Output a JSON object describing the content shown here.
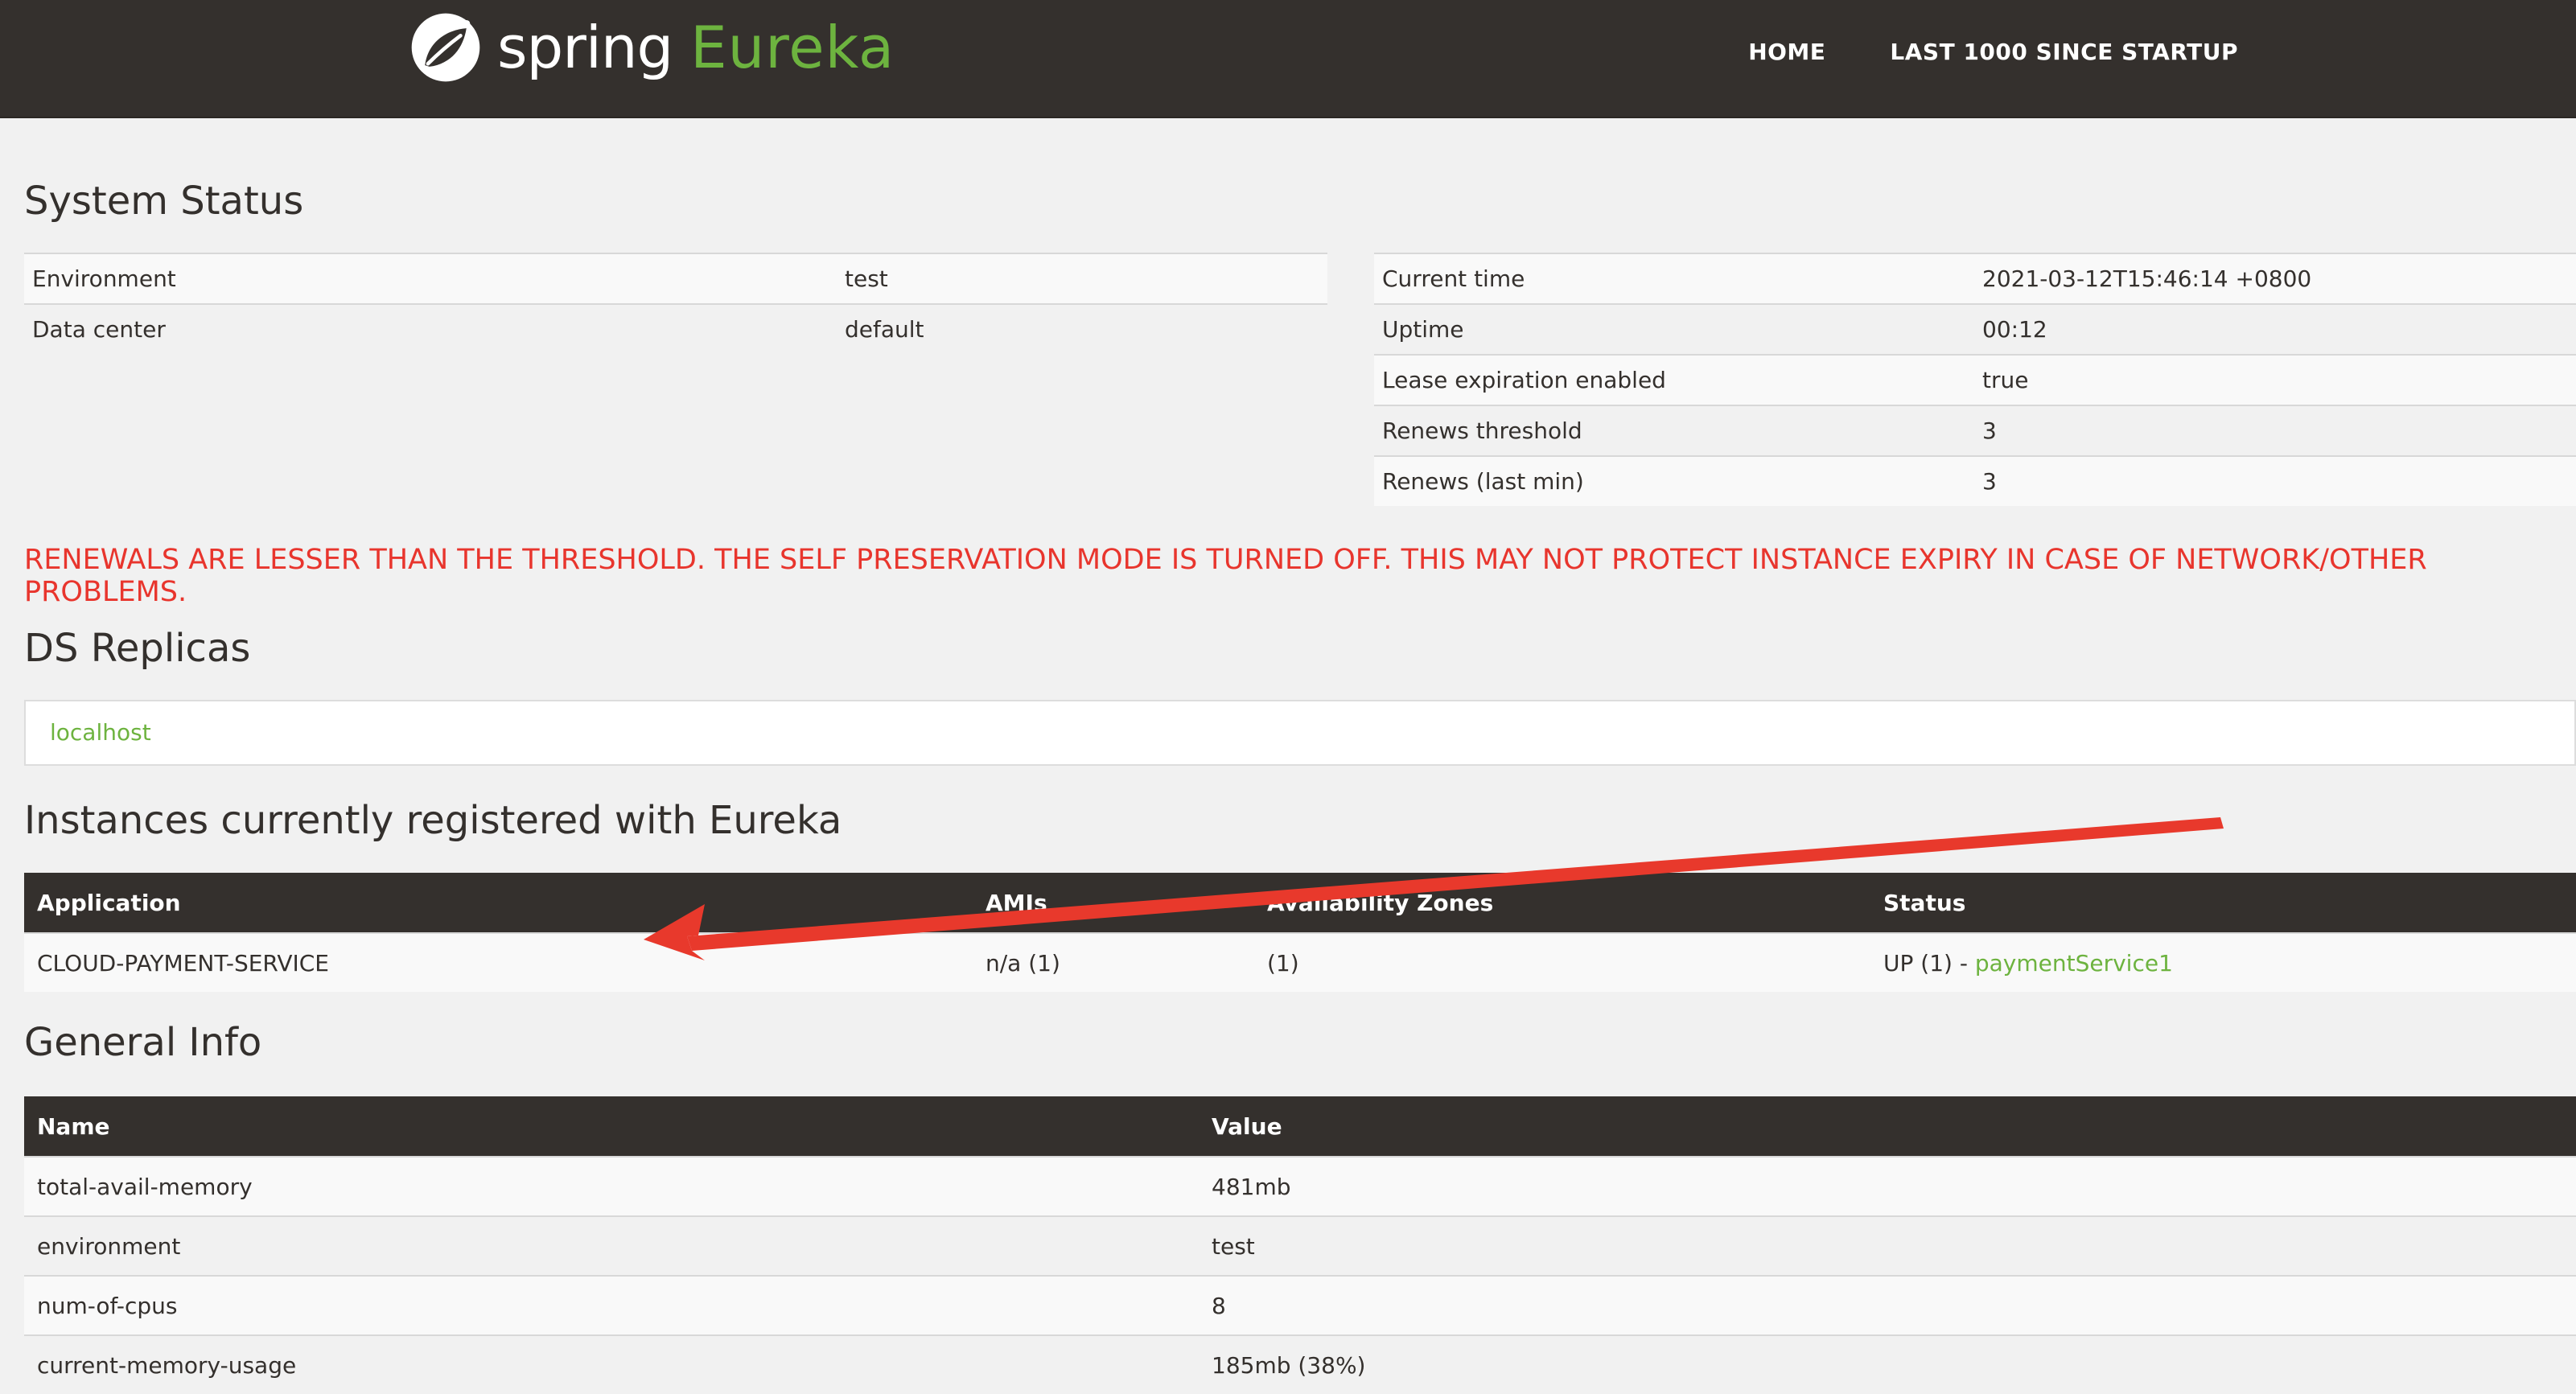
{
  "brand": {
    "word1": "spring",
    "word2": "Eureka"
  },
  "nav": {
    "home": "HOME",
    "last1000": "LAST 1000 SINCE STARTUP"
  },
  "system_status": {
    "title": "System Status",
    "left": [
      {
        "key": "Environment",
        "value": "test"
      },
      {
        "key": "Data center",
        "value": "default"
      }
    ],
    "right": [
      {
        "key": "Current time",
        "value": "2021-03-12T15:46:14 +0800"
      },
      {
        "key": "Uptime",
        "value": "00:12"
      },
      {
        "key": "Lease expiration enabled",
        "value": "true"
      },
      {
        "key": "Renews threshold",
        "value": "3"
      },
      {
        "key": "Renews (last min)",
        "value": "3"
      }
    ]
  },
  "warning": "RENEWALS ARE LESSER THAN THE THRESHOLD. THE SELF PRESERVATION MODE IS TURNED OFF. THIS MAY NOT PROTECT INSTANCE EXPIRY IN CASE OF NETWORK/OTHER PROBLEMS.",
  "replicas": {
    "title": "DS Replicas",
    "link": "localhost"
  },
  "instances": {
    "title": "Instances currently registered with Eureka",
    "headers": [
      "Application",
      "AMIs",
      "Availability Zones",
      "Status"
    ],
    "rows": [
      {
        "application": "CLOUD-PAYMENT-SERVICE",
        "amis": "n/a (1)",
        "zones": "(1)",
        "status_prefix": "UP (1) - ",
        "status_link": "paymentService1"
      }
    ]
  },
  "general_info": {
    "title": "General Info",
    "headers": [
      "Name",
      "Value"
    ],
    "rows": [
      {
        "name": "total-avail-memory",
        "value": "481mb"
      },
      {
        "name": "environment",
        "value": "test"
      },
      {
        "name": "num-of-cpus",
        "value": "8"
      },
      {
        "name": "current-memory-usage",
        "value": "185mb (38%)"
      }
    ]
  },
  "colors": {
    "brand_green": "#6db33f",
    "navbar": "#34302d",
    "warning": "#e8352d",
    "arrow": "#e8392c"
  }
}
